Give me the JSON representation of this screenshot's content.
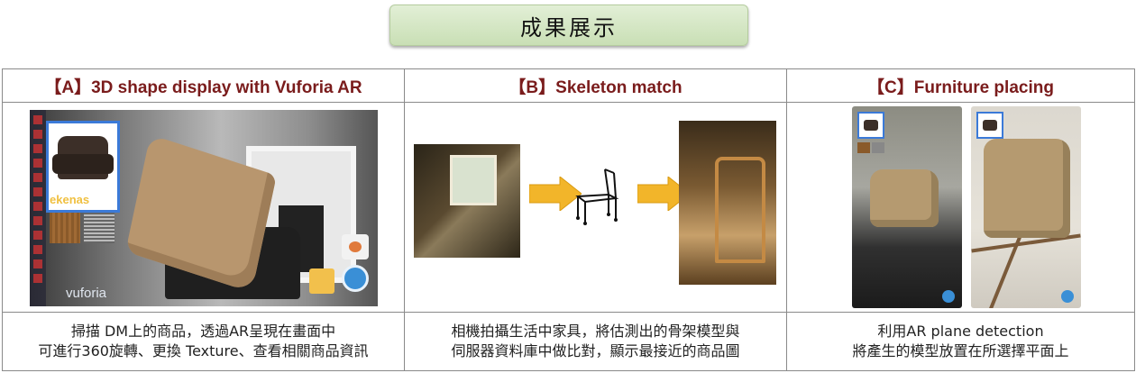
{
  "title": "成果展示",
  "panels": [
    {
      "id": "A",
      "header": "【A】3D shape display with Vuforia AR",
      "caption": [
        "掃描 DM上的商品，透過AR呈現在畫面中",
        "可進行360旋轉、更換 Texture、查看相關商品資訊"
      ],
      "overlay_text": {
        "product_name": "ekenas",
        "brand": "vuforia"
      }
    },
    {
      "id": "B",
      "header": "【B】Skeleton match",
      "caption": [
        "相機拍攝生活中家具，將估測出的骨架模型與",
        "伺服器資料庫中做比對，顯示最接近的商品圖"
      ]
    },
    {
      "id": "C",
      "header": "【C】Furniture placing",
      "caption": [
        "利用AR plane detection",
        "將產生的模型放置在所選擇平面上"
      ]
    }
  ],
  "colors": {
    "header_text": "#7a1c1c",
    "title_bg": "#d6e8c6",
    "arrow": "#f2b52a",
    "border": "#8a8a8a"
  }
}
